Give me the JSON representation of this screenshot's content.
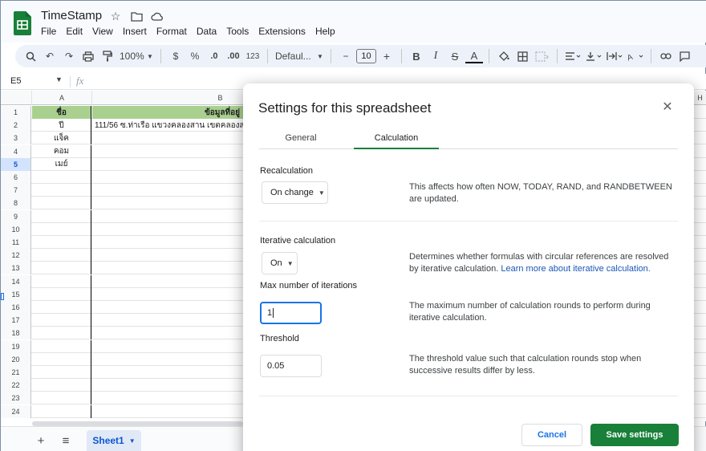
{
  "app": {
    "title": "TimeStamp",
    "menu": [
      "File",
      "Edit",
      "View",
      "Insert",
      "Format",
      "Data",
      "Tools",
      "Extensions",
      "Help"
    ],
    "brand_color": "#188038"
  },
  "toolbar": {
    "zoom": "100%",
    "currency": "$",
    "percent": "%",
    "decimal_decrease": ".0",
    "decimal_increase": ".00",
    "number_format": "123",
    "font": "Defaul...",
    "font_size": "10",
    "minus": "−",
    "plus": "+",
    "bold": "B",
    "italic": "I",
    "strike": "S",
    "text_color": "A"
  },
  "formula_bar": {
    "cell_ref": "E5",
    "fx": "fx"
  },
  "grid": {
    "columns": [
      "A",
      "B",
      "H"
    ],
    "header_row": {
      "a": "ชื่อ",
      "b": "ข้อมูลที่อยู่"
    },
    "rows": [
      {
        "num": "1"
      },
      {
        "num": "2",
        "a": "ปี",
        "b": "111/56 ซ.ท่าเรือ แขวงคลองสาน เขตคลองส"
      },
      {
        "num": "3",
        "a": "แจ็ค"
      },
      {
        "num": "4",
        "a": "คอม"
      },
      {
        "num": "5",
        "a": "เมย์"
      },
      {
        "num": "6"
      },
      {
        "num": "7"
      },
      {
        "num": "8"
      },
      {
        "num": "9"
      },
      {
        "num": "10"
      },
      {
        "num": "11"
      },
      {
        "num": "12"
      },
      {
        "num": "13"
      },
      {
        "num": "14"
      },
      {
        "num": "15"
      },
      {
        "num": "16"
      },
      {
        "num": "17"
      },
      {
        "num": "18"
      },
      {
        "num": "19"
      },
      {
        "num": "20"
      },
      {
        "num": "21"
      },
      {
        "num": "22"
      },
      {
        "num": "23"
      },
      {
        "num": "24"
      }
    ],
    "header_fill": "#a9d08e"
  },
  "sheets": {
    "active": "Sheet1"
  },
  "dialog": {
    "title": "Settings for this spreadsheet",
    "tabs": [
      "General",
      "Calculation"
    ],
    "active_tab": "Calculation",
    "recalculation": {
      "label": "Recalculation",
      "value": "On change",
      "description": "This affects how often NOW, TODAY, RAND, and RANDBETWEEN are updated."
    },
    "iterative": {
      "label": "Iterative calculation",
      "value": "On",
      "description": "Determines whether formulas with circular references are resolved by iterative calculation.",
      "link": "Learn more about iterative calculation."
    },
    "max_iterations": {
      "label": "Max number of iterations",
      "value": "1",
      "description": "The maximum number of calculation rounds to perform during iterative calculation."
    },
    "threshold": {
      "label": "Threshold",
      "value": "0.05",
      "description": "The threshold value such that calculation rounds stop when successive results differ by less."
    },
    "cancel_label": "Cancel",
    "save_label": "Save settings"
  }
}
